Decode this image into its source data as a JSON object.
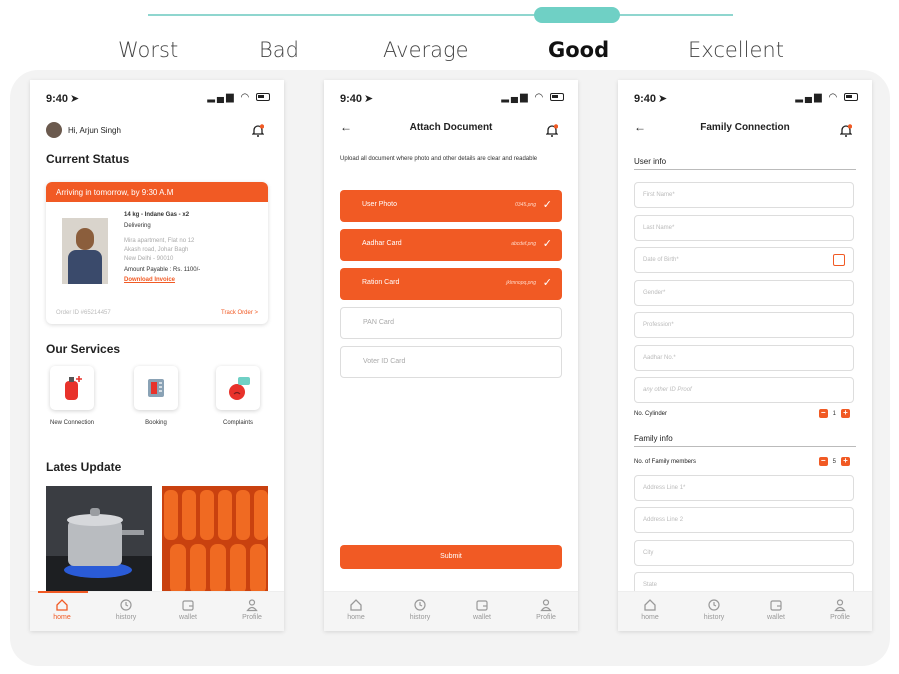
{
  "scale": {
    "labels": [
      "Worst",
      "Bad",
      "Average",
      "Good",
      "Excellent"
    ],
    "selected": "Good"
  },
  "status_bar": {
    "time": "9:40"
  },
  "bottom_nav": [
    "home",
    "history",
    "wallet",
    "Profile"
  ],
  "screen_home": {
    "greeting": "Hi, Arjun Singh",
    "current_status_title": "Current Status",
    "banner": "Arriving in tomorrow, by 9:30 A.M",
    "item": "14 kg - Indane Gas - x2",
    "status": "Delivering",
    "address_1": "Mira apartment, Flat no 12",
    "address_2": "Akash road, Johar Bagh",
    "address_3": "New Delhi - 90010",
    "amount": "Amount Payable : Rs. 1100/-",
    "invoice_link": "Download Invoice",
    "order_id": "Order ID #65214457",
    "track_order": "Track Order  >",
    "services_title": "Our Services",
    "services": [
      "New Connection",
      "Booking",
      "Complaints"
    ],
    "updates_title": "Lates Update"
  },
  "screen_docs": {
    "title": "Attach Document",
    "intro": "Upload all document where photo and other details are clear and readable",
    "uploaded": [
      {
        "label": "User Photo",
        "file": "0345.png"
      },
      {
        "label": "Aadhar Card",
        "file": "abcdef.png"
      },
      {
        "label": "Ration Card",
        "file": "jklmnopq.png"
      }
    ],
    "pending": [
      "PAN Card",
      "Voter ID Card"
    ],
    "submit": "Submit"
  },
  "screen_family": {
    "title": "Family Connection",
    "user_info": "User info",
    "fields_user": [
      "First Name*",
      "Last Name*",
      "Date of Birth*",
      "Gender*",
      "Profession*",
      "Aadhar No.*",
      "any other ID Proof"
    ],
    "cylinder_label": "No. Cylinder",
    "cylinder_value": "1",
    "family_info": "Family info",
    "members_label": "No. of Family members",
    "members_value": "5",
    "fields_family": [
      "Address Line 1*",
      "Address Line 2",
      "City",
      "State"
    ]
  },
  "colors": {
    "accent": "#f15a24",
    "scale": "#6fd0c5"
  }
}
